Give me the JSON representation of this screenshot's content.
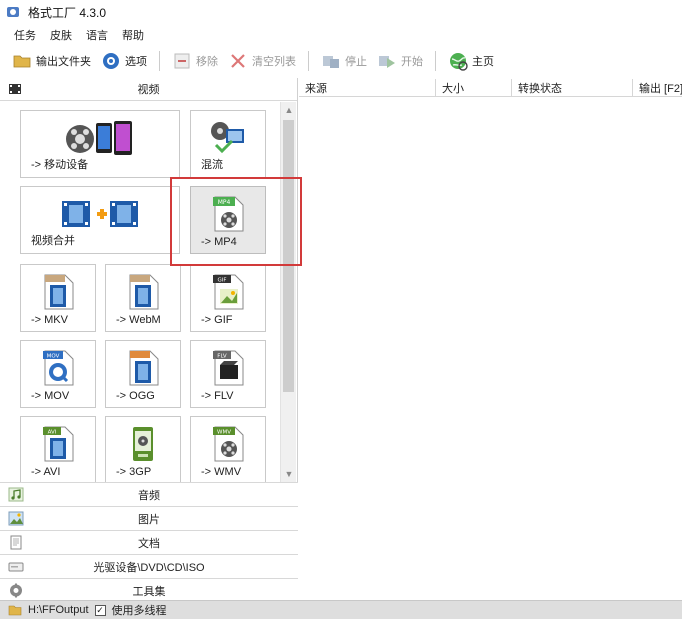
{
  "window": {
    "title": "格式工厂 4.3.0",
    "icon": "format-factory-icon"
  },
  "menu": [
    "任务",
    "皮肤",
    "语言",
    "帮助"
  ],
  "toolbar": {
    "output_folder": "输出文件夹",
    "options": "选项",
    "remove": "移除",
    "clear_list": "清空列表",
    "stop": "停止",
    "start": "开始",
    "home": "主页"
  },
  "video_section": {
    "label": "视频"
  },
  "tiles": [
    {
      "label": "-> 移动设备",
      "icon": "mobile-device-icon"
    },
    {
      "label": "混流",
      "icon": "mux-icon"
    },
    {
      "label": "视频合并",
      "icon": "video-join-icon"
    },
    {
      "label": "-> MP4",
      "icon": "mp4-file-icon",
      "selected": true
    },
    {
      "label": "-> MKV",
      "icon": "mkv-file-icon"
    },
    {
      "label": "-> WebM",
      "icon": "webm-file-icon"
    },
    {
      "label": "-> GIF",
      "icon": "gif-file-icon"
    },
    {
      "label": "-> MOV",
      "icon": "mov-file-icon"
    },
    {
      "label": "-> OGG",
      "icon": "ogg-file-icon"
    },
    {
      "label": "-> FLV",
      "icon": "flv-file-icon"
    },
    {
      "label": "-> AVI",
      "icon": "avi-file-icon"
    },
    {
      "label": "-> 3GP",
      "icon": "3gp-file-icon"
    },
    {
      "label": "-> WMV",
      "icon": "wmv-file-icon"
    }
  ],
  "file_badges": {
    "mp4": "MP4",
    "mkv": "MKV",
    "webm": "WebM",
    "gif": "GIF",
    "mov": "MOV",
    "ogg": "OGG",
    "flv": "FLV",
    "avi": "AVI",
    "gp3": "3GP",
    "wmv": "WMV"
  },
  "categories": [
    {
      "label": "音频",
      "icon": "audio-icon"
    },
    {
      "label": "图片",
      "icon": "picture-icon"
    },
    {
      "label": "文档",
      "icon": "document-icon"
    },
    {
      "label": "光驱设备\\DVD\\CD\\ISO",
      "icon": "disc-drive-icon"
    },
    {
      "label": "工具集",
      "icon": "tools-icon"
    }
  ],
  "table": {
    "columns": [
      "来源",
      "大小",
      "转换状态",
      "输出 [F2]"
    ]
  },
  "status": {
    "output_path": "H:\\FFOutput",
    "multithread_label": "使用多线程",
    "multithread_checked": true
  },
  "colors": {
    "accent": "#d23a3a",
    "film": "#1e5aa8"
  }
}
